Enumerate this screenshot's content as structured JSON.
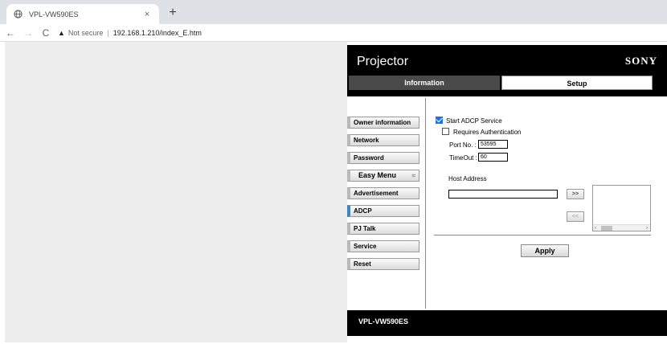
{
  "browser": {
    "tab_title": "VPL-VW590ES",
    "tab_close": "×",
    "new_tab": "+",
    "back": "←",
    "forward": "→",
    "reload": "C",
    "security_icon": "▲",
    "security_text": "Not secure",
    "separator": "|",
    "url": "192.168.1.210/index_E.htm"
  },
  "header": {
    "title": "Projector",
    "brand": "SONY",
    "tabs": [
      {
        "label": "Information"
      },
      {
        "label": "Setup"
      }
    ]
  },
  "sidebar": {
    "items": [
      {
        "label": "Owner information"
      },
      {
        "label": "Network"
      },
      {
        "label": "Password"
      },
      {
        "label": "Easy Menu",
        "chevron": "≈"
      },
      {
        "label": "Advertisement"
      },
      {
        "label": "ADCP"
      },
      {
        "label": "PJ Talk"
      },
      {
        "label": "Service"
      },
      {
        "label": "Reset"
      }
    ],
    "active": "ADCP"
  },
  "form": {
    "start_adcp_label": "Start ADCP Service",
    "start_adcp_checked": true,
    "requires_auth_label": "Requires Authentication",
    "requires_auth_checked": false,
    "port_label": "Port No. :",
    "port_value": "53595",
    "timeout_label": "TimeOut :",
    "timeout_value": "60",
    "host_address_label": "Host Address",
    "host_address_value": "",
    "add_button": ">>",
    "remove_button": "<<",
    "scroll_left": "‹",
    "scroll_right": "›",
    "apply_button": "Apply"
  },
  "footer": {
    "model": "VPL-VW590ES"
  }
}
